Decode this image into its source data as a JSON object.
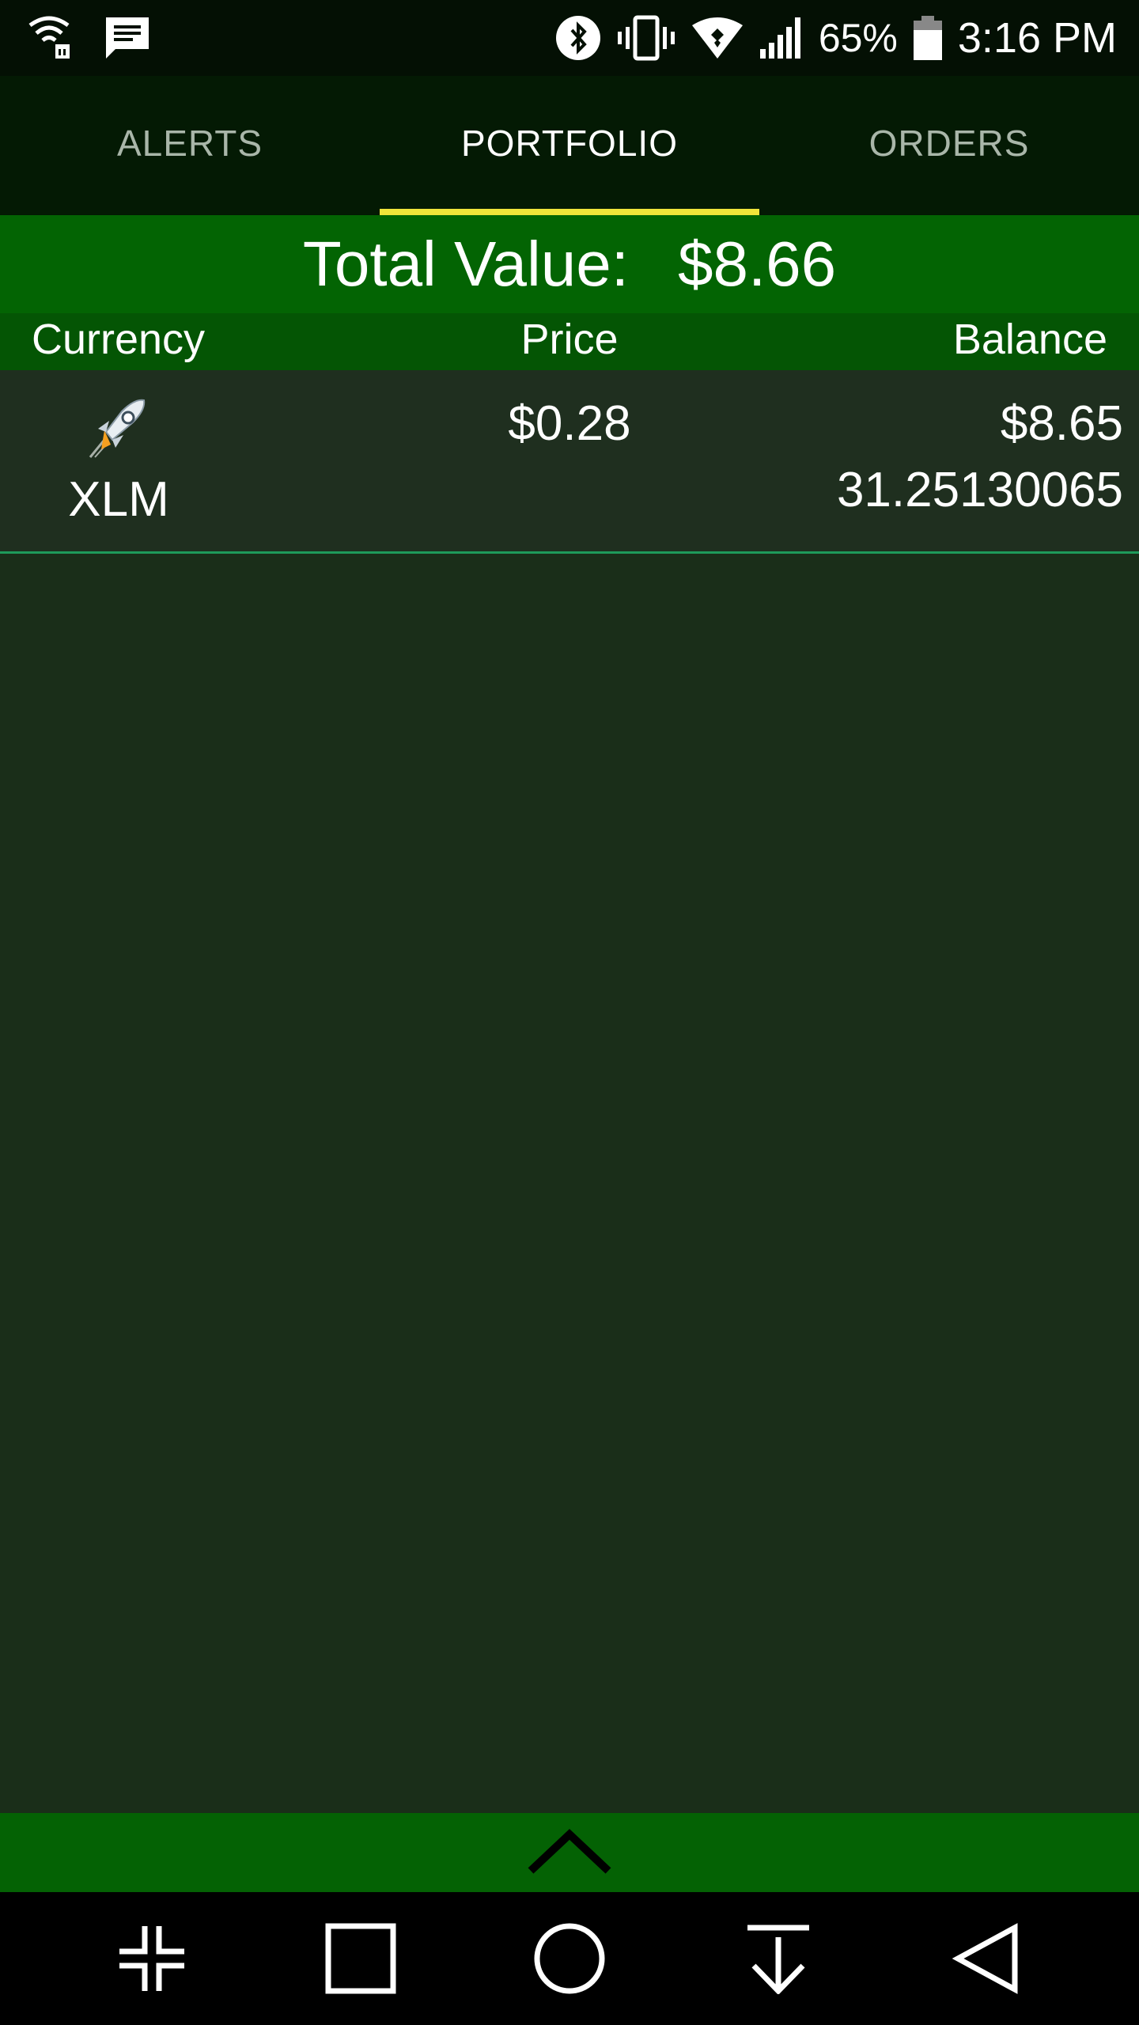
{
  "status_bar": {
    "battery_percent": "65%",
    "time": "3:16 PM",
    "icons": [
      "wifi-calling-icon",
      "message-icon",
      "bluetooth-icon",
      "vibrate-icon",
      "wifi-icon",
      "signal-icon",
      "battery-icon"
    ]
  },
  "tabs": [
    {
      "label": "ALERTS",
      "active": false
    },
    {
      "label": "PORTFOLIO",
      "active": true
    },
    {
      "label": "ORDERS",
      "active": false
    }
  ],
  "total": {
    "label": "Total Value:",
    "value": "$8.66"
  },
  "columns": {
    "currency": "Currency",
    "price": "Price",
    "balance": "Balance"
  },
  "holdings": [
    {
      "icon": "rocket-icon",
      "symbol": "XLM",
      "price": "$0.28",
      "value": "$8.65",
      "amount": "31.25130065"
    }
  ],
  "colors": {
    "status_bar": "#041004",
    "tab_bar": "#041a04",
    "tab_indicator": "#f0e43a",
    "header_green": "#036403",
    "row_background": "#1f2f1f",
    "row_divider": "#1e9a5a",
    "background": "#1a2e19"
  },
  "nav_bar": {
    "buttons": [
      "collapse-icon",
      "recents-icon",
      "home-icon",
      "download-icon",
      "back-icon"
    ]
  }
}
